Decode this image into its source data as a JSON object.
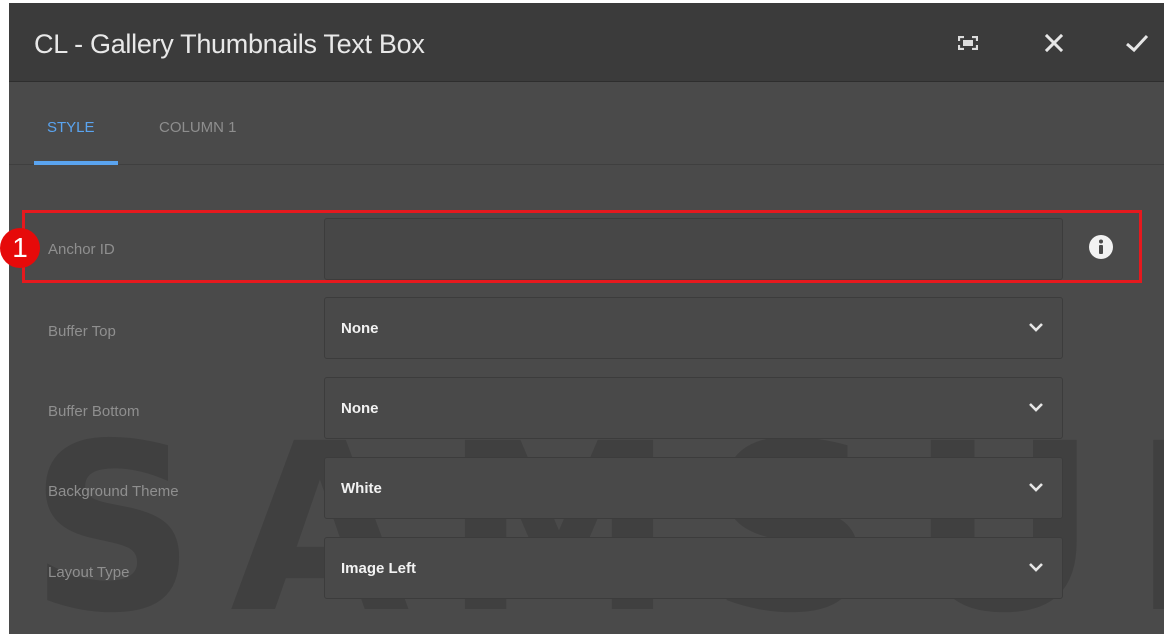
{
  "dialog": {
    "title": "CL - Gallery Thumbnails Text Box",
    "icons": {
      "fullscreen": "fullscreen-icon",
      "close": "close-icon",
      "confirm": "check-icon"
    }
  },
  "tabs": [
    {
      "label": "STYLE",
      "active": true
    },
    {
      "label": "COLUMN 1",
      "active": false
    }
  ],
  "form": {
    "anchor_id": {
      "label": "Anchor ID",
      "value": "",
      "info_icon": "info-icon"
    },
    "buffer_top": {
      "label": "Buffer Top",
      "value": "None"
    },
    "buffer_bottom": {
      "label": "Buffer Bottom",
      "value": "None"
    },
    "background_theme": {
      "label": "Background Theme",
      "value": "White"
    },
    "layout_type": {
      "label": "Layout Type",
      "value": "Image Left"
    }
  },
  "annotation": {
    "badge": "1"
  },
  "watermark": {
    "text": "SAMSUNG"
  },
  "colors": {
    "accent": "#5aa4f0",
    "highlight": "#e6191e",
    "background": "#4a4a4a",
    "titlebar": "#3b3b3b"
  }
}
